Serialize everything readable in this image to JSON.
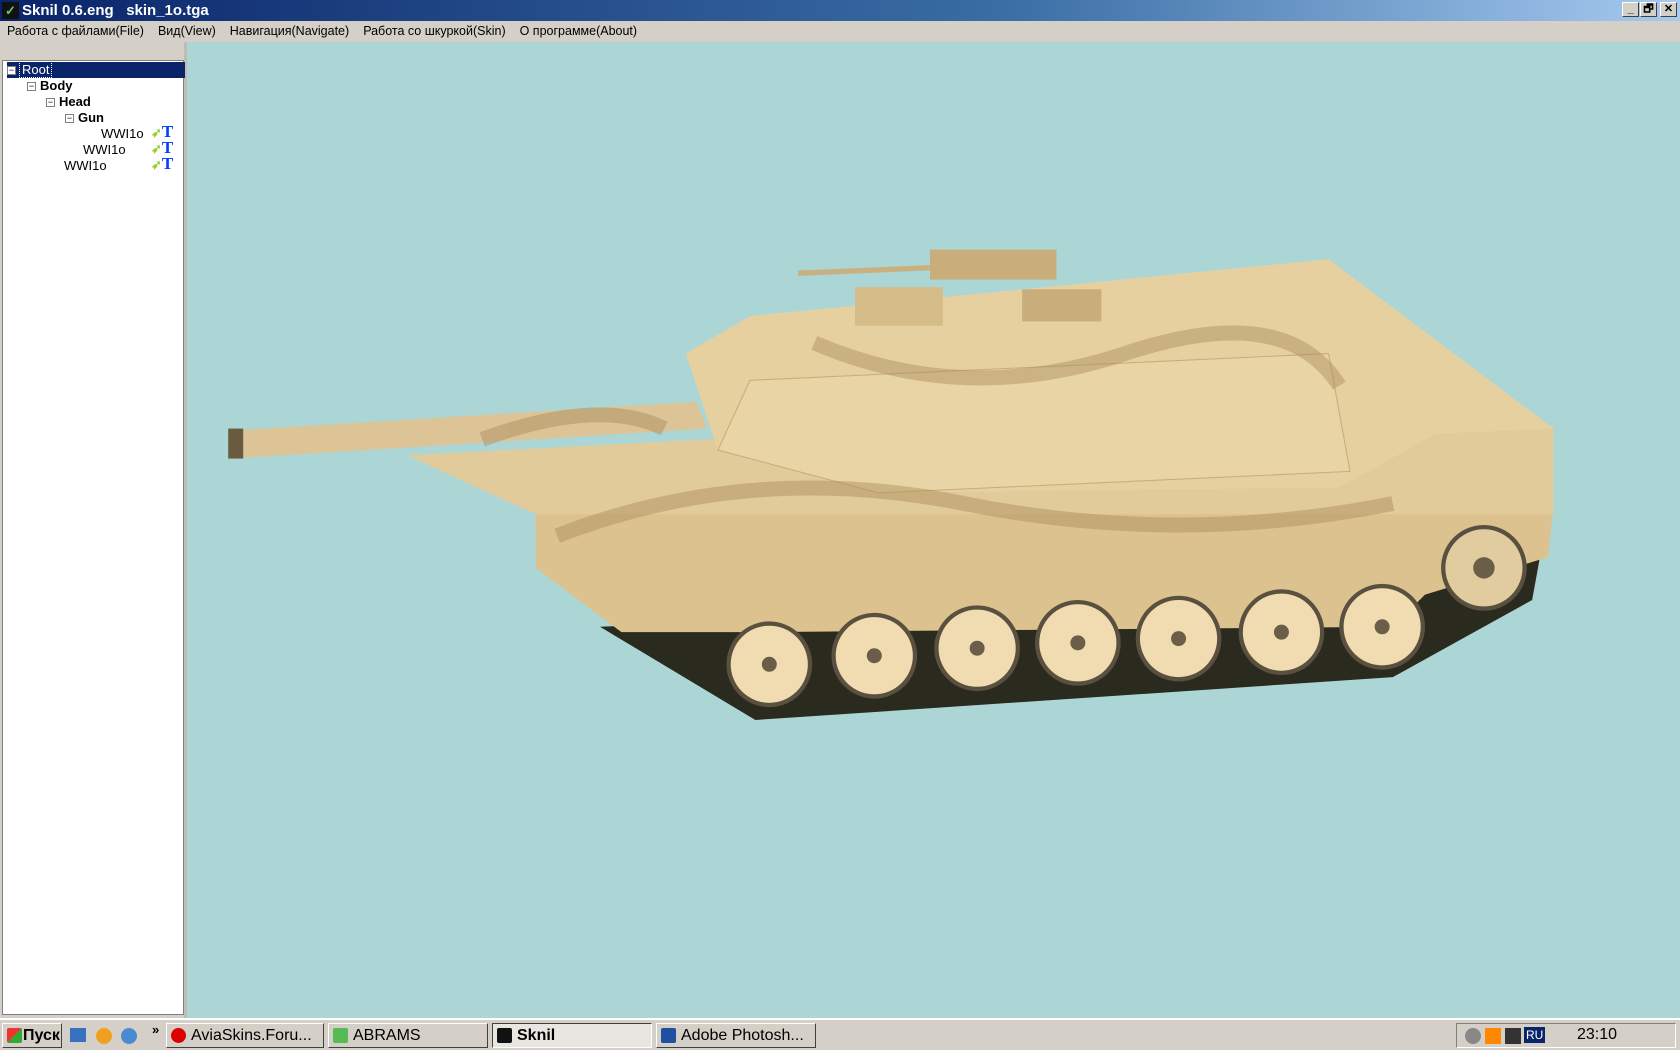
{
  "window": {
    "title": "Sknil 0.6.eng   skin_1o.tga",
    "minimize": "_",
    "restore": "🗗",
    "close": "✕"
  },
  "menu": [
    "Работа с файлами(File)",
    "Вид(View)",
    "Навигация(Navigate)",
    "Работа со шкуркой(Skin)",
    "О программе(About)"
  ],
  "tree": {
    "root": "Root",
    "body": "Body",
    "head": "Head",
    "gun": "Gun",
    "mesh_gun": "WWI1o",
    "mesh_head": "WWI1o",
    "mesh_body": "WWI1o",
    "arrow": "➶",
    "tex": "T",
    "expander": "−"
  },
  "taskbar": {
    "start": "Пуск",
    "chevron": "»",
    "tasks": [
      "AviaSkins.Foru...",
      "ABRAMS",
      "Sknil",
      "Adobe Photosh..."
    ],
    "lang": "RU",
    "clock": "23:10"
  },
  "colors": {
    "viewport": "#acd6d6",
    "tan": "#e2cb9a",
    "shade": "#b89c6a"
  }
}
